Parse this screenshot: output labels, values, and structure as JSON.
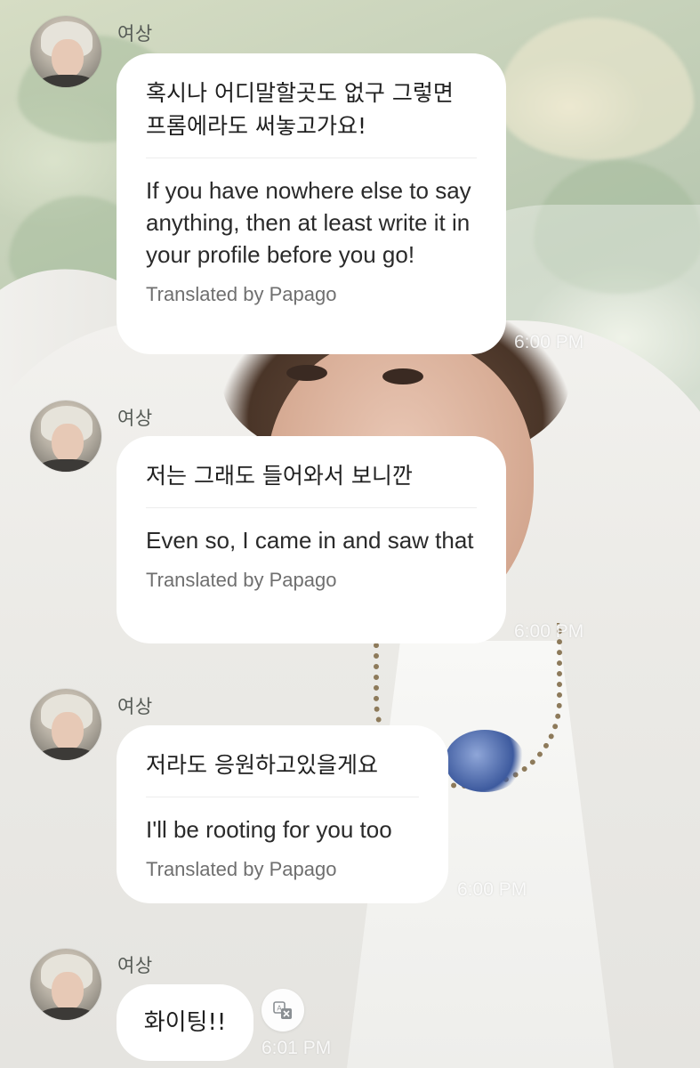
{
  "conversation": {
    "messages": [
      {
        "sender": "여상",
        "original": "혹시나 어디말할곳도 없구 그렇면 프롬에라도 써놓고가요!",
        "translation": "If you have nowhere else to say anything, then at least write it in your profile before you go!",
        "credit": "Translated by Papago",
        "time": "6:00 PM"
      },
      {
        "sender": "여상",
        "original": "저는 그래도 들어와서 보니깐",
        "translation": "Even so, I came in and saw that",
        "credit": "Translated by Papago",
        "time": "6:00 PM"
      },
      {
        "sender": "여상",
        "original": "저라도 응원하고있을게요",
        "translation": "I'll be rooting for you too",
        "credit": "Translated by Papago",
        "time": "6:00 PM"
      },
      {
        "sender": "여상",
        "original": "화이팅!!",
        "time": "6:01 PM",
        "translate_icon": "translate-icon"
      }
    ]
  },
  "colors": {
    "bubble_background": "#ffffff",
    "sender_name": "#555a55",
    "credit_text": "#6f6f6f",
    "timestamp": "#ffffff"
  }
}
